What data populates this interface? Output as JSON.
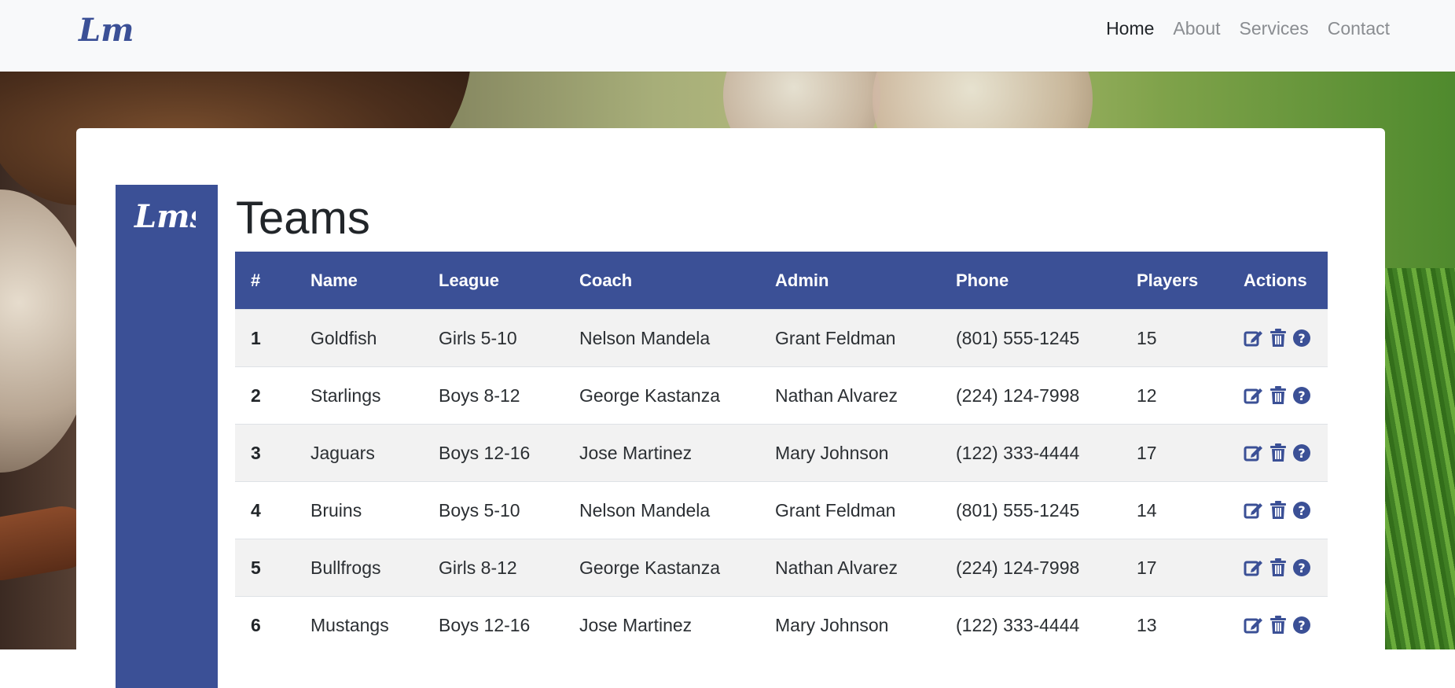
{
  "brand": {
    "logo_text": "Lms"
  },
  "nav": {
    "items": [
      "Home",
      "About",
      "Services",
      "Contact"
    ],
    "active": "Home"
  },
  "page": {
    "title": "Teams"
  },
  "table": {
    "headers": [
      "#",
      "Name",
      "League",
      "Coach",
      "Admin",
      "Phone",
      "Players",
      "Actions"
    ],
    "rows": [
      {
        "num": "1",
        "name": "Goldfish",
        "league": "Girls 5-10",
        "coach": "Nelson Mandela",
        "admin": "Grant Feldman",
        "phone": "(801) 555-1245",
        "players": "15"
      },
      {
        "num": "2",
        "name": "Starlings",
        "league": "Boys 8-12",
        "coach": "George Kastanza",
        "admin": "Nathan Alvarez",
        "phone": "(224) 124-7998",
        "players": "12"
      },
      {
        "num": "3",
        "name": "Jaguars",
        "league": "Boys 12-16",
        "coach": "Jose Martinez",
        "admin": "Mary Johnson",
        "phone": "(122) 333-4444",
        "players": "17"
      },
      {
        "num": "4",
        "name": "Bruins",
        "league": "Boys 5-10",
        "coach": "Nelson Mandela",
        "admin": "Grant Feldman",
        "phone": "(801) 555-1245",
        "players": "14"
      },
      {
        "num": "5",
        "name": "Bullfrogs",
        "league": "Girls 8-12",
        "coach": "George Kastanza",
        "admin": "Nathan Alvarez",
        "phone": "(224) 124-7998",
        "players": "17"
      },
      {
        "num": "6",
        "name": "Mustangs",
        "league": "Boys 12-16",
        "coach": "Jose Martinez",
        "admin": "Mary Johnson",
        "phone": "(122) 333-4444",
        "players": "13"
      }
    ]
  },
  "actions": {
    "icons": [
      "edit-icon",
      "trash-icon",
      "help-icon"
    ]
  },
  "colors": {
    "primary": "#3b5096",
    "navbar_bg": "#f8f9fa",
    "stripe": "#f2f2f2"
  }
}
